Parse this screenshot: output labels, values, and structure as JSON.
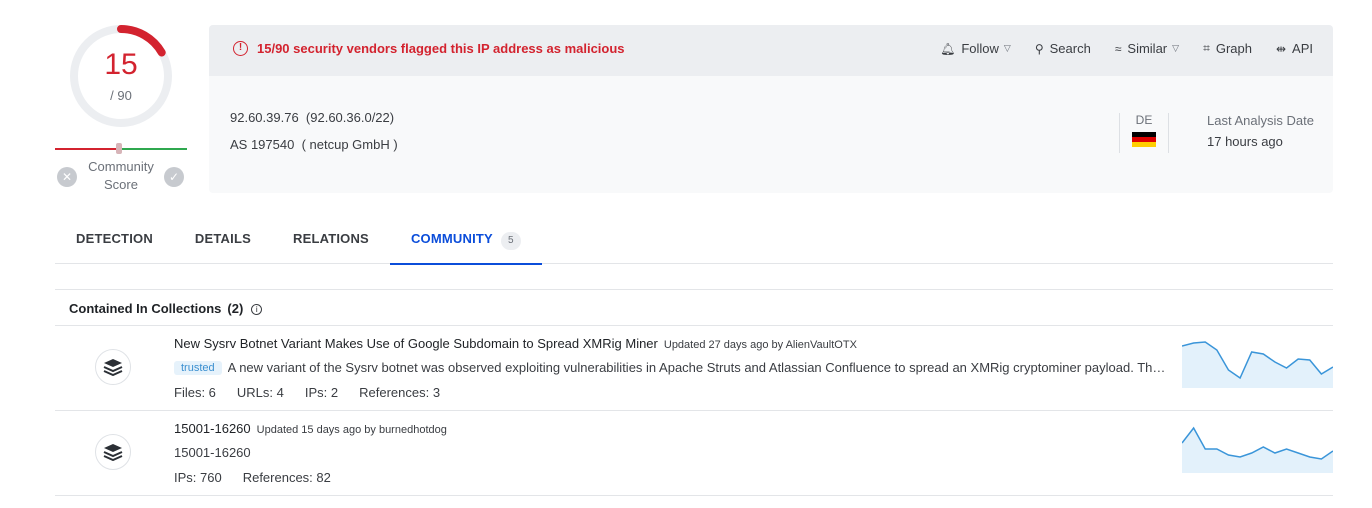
{
  "score": {
    "detections": "15",
    "total": "/ 90",
    "community_label": "Community Score",
    "gauge_fraction": 0.1667,
    "colors": {
      "malicious": "#d3232f",
      "track": "#eceef1"
    }
  },
  "alert": {
    "text": "15/90 security vendors flagged this IP address as malicious",
    "icon": "exclamation-circle-icon"
  },
  "actions": [
    {
      "label": "Follow",
      "icon": "bell-icon",
      "dropdown": true
    },
    {
      "label": "Search",
      "icon": "search-icon",
      "dropdown": false
    },
    {
      "label": "Similar",
      "icon": "similar-icon",
      "dropdown": true
    },
    {
      "label": "Graph",
      "icon": "graph-icon",
      "dropdown": false
    },
    {
      "label": "API",
      "icon": "api-icon",
      "dropdown": false
    }
  ],
  "ip": {
    "address": "92.60.39.76",
    "network": "(92.60.36.0/22)",
    "as_line": "AS 197540",
    "owner": "( netcup GmbH )",
    "country_code": "DE",
    "flag_colors": [
      "#000000",
      "#dd0000",
      "#ffce00"
    ],
    "last_analysis_label": "Last Analysis Date",
    "last_analysis_value": "17 hours ago"
  },
  "tabs": [
    {
      "label": "DETECTION",
      "active": false
    },
    {
      "label": "DETAILS",
      "active": false
    },
    {
      "label": "RELATIONS",
      "active": false
    },
    {
      "label": "COMMUNITY",
      "active": true,
      "badge": "5"
    }
  ],
  "collections": {
    "title": "Contained In Collections",
    "count": "(2)",
    "items": [
      {
        "title": "New Sysrv Botnet Variant Makes Use of Google Subdomain to Spread XMRig Miner",
        "meta": "Updated 27 days ago by AlienVaultOTX",
        "tag": "trusted",
        "description": "A new variant of the Sysrv botnet was observed exploiting vulnerabilities in Apache Struts and Atlassian Confluence to spread an XMRig cryptominer payload. Th…",
        "stats": [
          "Files: 6",
          "URLs: 4",
          "IPs: 2",
          "References: 3"
        ],
        "sparkline": [
          6,
          3,
          2,
          10,
          30,
          38,
          12,
          14,
          22,
          28,
          19,
          20,
          34,
          27
        ]
      },
      {
        "title": "15001-16260",
        "meta": "Updated 15 days ago by burnedhotdog",
        "tag": "",
        "description": "15001-16260",
        "stats": [
          "IPs: 760",
          "References: 82"
        ],
        "sparkline": [
          18,
          3,
          24,
          24,
          30,
          32,
          28,
          22,
          28,
          24,
          28,
          32,
          34,
          26
        ]
      }
    ]
  }
}
